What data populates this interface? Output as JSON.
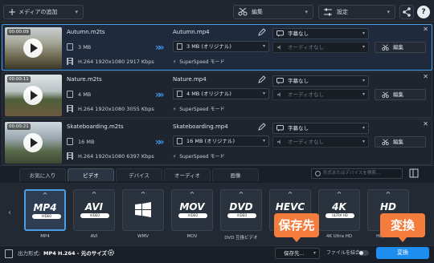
{
  "toolbar": {
    "add_media_label": "メディアの追加",
    "edit_label": "編集",
    "settings_label": "設定",
    "help_label": "?"
  },
  "files": [
    {
      "time": "00:00:09",
      "src_name": "Autumn.m2ts",
      "src_size": "3 MB",
      "src_info": "H.264 1920x1080 2917 Kbps",
      "out_name": "Autumn.mp4",
      "out_size": "3 MB (オリジナル)",
      "superspeed": "SuperSpeed モード",
      "subtitle": "字幕なし",
      "audio": "オーディオなし",
      "edit_label": "編集",
      "selected": true
    },
    {
      "time": "00:00:11",
      "src_name": "Nature.m2ts",
      "src_size": "4 MB",
      "src_info": "H.264 1920x1080 3055 Kbps",
      "out_name": "Nature.mp4",
      "out_size": "4 MB (オリジナル)",
      "superspeed": "SuperSpeed モード",
      "subtitle": "字幕なし",
      "audio": "オーディオなし",
      "edit_label": "編集",
      "selected": false
    },
    {
      "time": "00:00:21",
      "src_name": "Skateboarding.m2ts",
      "src_size": "16 MB",
      "src_info": "H.264 1920x1080 6397 Kbps",
      "out_name": "Skateboarding.mp4",
      "out_size": "16 MB (オリジナル)",
      "superspeed": "SuperSpeed モード",
      "subtitle": "字幕なし",
      "audio": "オーディオなし",
      "edit_label": "編集",
      "selected": false
    }
  ],
  "tabs": [
    "お気に入り",
    "ビデオ",
    "デバイス",
    "オーディオ",
    "画像"
  ],
  "active_tab": "ビデオ",
  "search_placeholder": "形式またはデバイスを検索...",
  "formats": [
    {
      "logo": "MP4",
      "sublogo": "VIDEO",
      "label": "MP4",
      "active": true
    },
    {
      "logo": "AVI",
      "sublogo": "VIDEO",
      "label": "AVI",
      "active": false
    },
    {
      "logo": "",
      "sublogo": "",
      "label": "WMV",
      "active": false
    },
    {
      "logo": "MOV",
      "sublogo": "VIDEO",
      "label": "MOV",
      "active": false
    },
    {
      "logo": "DVD",
      "sublogo": "VIDEO",
      "label": "DVD 互換ビデオ",
      "active": false
    },
    {
      "logo": "HEVC",
      "sublogo": "",
      "label": "HEVC",
      "active": false
    },
    {
      "logo": "4K",
      "sublogo": "ULTRA HD",
      "label": "4K Ultra HD",
      "active": false
    },
    {
      "logo": "HD",
      "sublogo": "",
      "label": "HD/Full HD",
      "active": false
    }
  ],
  "bottom": {
    "output_format_label": "出力形式:",
    "output_format_value": "MP4 H.264 - 元のサイズ",
    "save_to": "保存先...",
    "merge_label": "ファイルを結合:",
    "convert_label": "変換"
  },
  "callouts": {
    "save": "保存先",
    "convert": "変換"
  },
  "colors": {
    "accent": "#1f8cf0",
    "callout": "#f47c3c",
    "background": "#1b2028"
  }
}
